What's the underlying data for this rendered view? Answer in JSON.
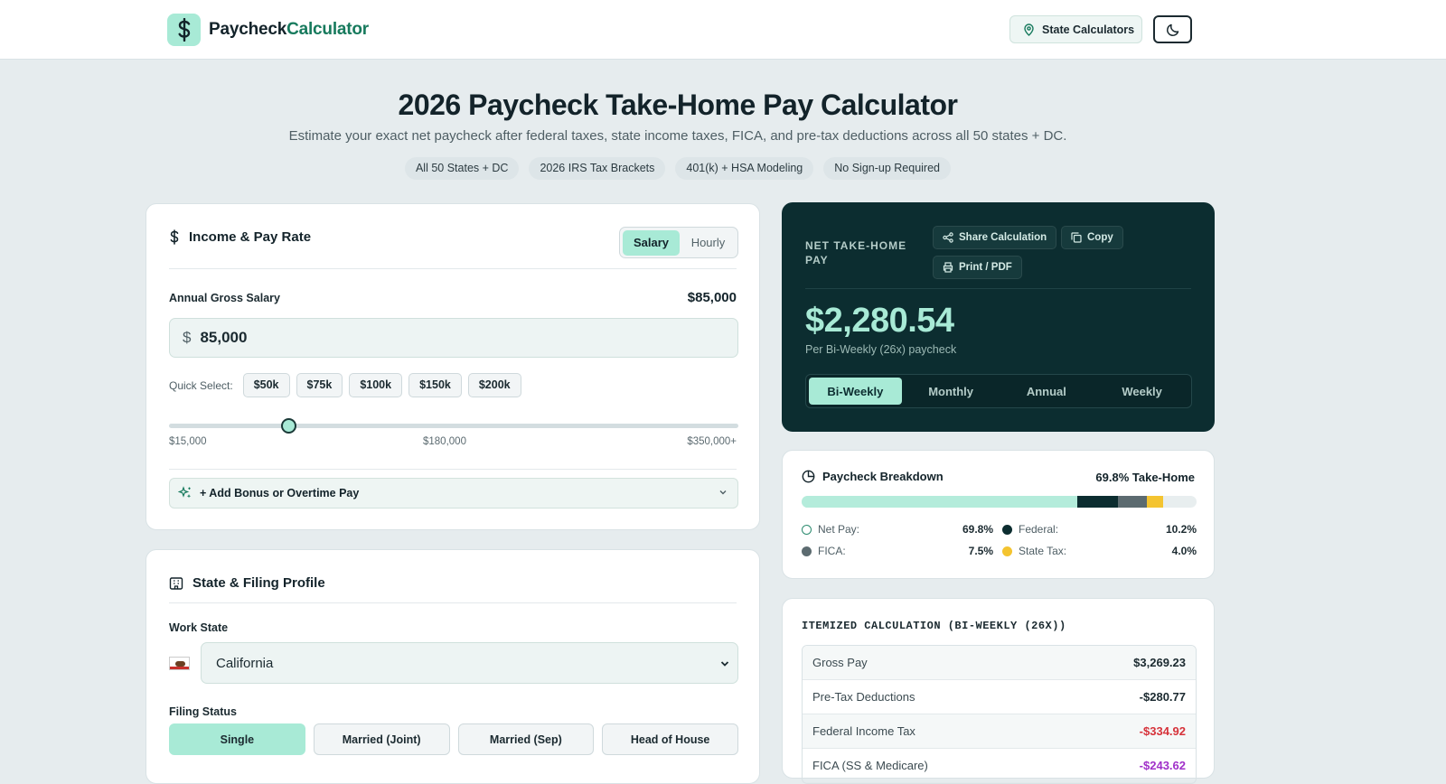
{
  "header": {
    "logo_text_a": "Paycheck",
    "logo_text_b": "Calculator",
    "state_calculators_label": "State Calculators"
  },
  "hero": {
    "title": "2026 Paycheck Take-Home Pay Calculator",
    "subtitle": "Estimate your exact net paycheck after federal taxes, state income taxes, FICA, and pre-tax deductions across all 50 states + DC.",
    "chips": [
      "All 50 States + DC",
      "2026 IRS Tax Brackets",
      "401(k) + HSA Modeling",
      "No Sign-up Required"
    ]
  },
  "income": {
    "title": "Income & Pay Rate",
    "mode_salary": "Salary",
    "mode_hourly": "Hourly",
    "salary_label": "Annual Gross Salary",
    "salary_display": "$85,000",
    "currency": "$",
    "salary_input_value": "85,000",
    "quick_label": "Quick Select:",
    "quick_options": [
      "$50k",
      "$75k",
      "$100k",
      "$150k",
      "$200k"
    ],
    "slider_min_label": "$15,000",
    "slider_mid_label": "$180,000",
    "slider_max_label": "$350,000+",
    "slider_value": 85000,
    "bonus_label": "+ Add Bonus or Overtime Pay"
  },
  "profile": {
    "title": "State & Filing Profile",
    "work_state_label": "Work State",
    "work_state_value": "California",
    "filing_label": "Filing Status",
    "filing_options": [
      "Single",
      "Married (Joint)",
      "Married (Sep)",
      "Head of House"
    ],
    "filing_selected": "Single"
  },
  "result": {
    "net_label": "NET TAKE-HOME PAY",
    "share_label": "Share Calculation",
    "copy_label": "Copy",
    "print_label": "Print / PDF",
    "amount": "$2,280.54",
    "per_text": "Per Bi-Weekly (26x) paycheck",
    "frequencies": [
      "Bi-Weekly",
      "Monthly",
      "Annual",
      "Weekly"
    ],
    "selected_frequency": "Bi-Weekly"
  },
  "breakdown": {
    "title": "Paycheck Breakdown",
    "take_home_text": "69.8% Take-Home",
    "segments": [
      {
        "name": "Net Pay:",
        "value": "69.8%",
        "percent": 69.8,
        "color": "#b4ecdb"
      },
      {
        "name": "Federal:",
        "value": "10.2%",
        "percent": 10.2,
        "color": "#0c2d30"
      },
      {
        "name": "FICA:",
        "value": "7.5%",
        "percent": 7.5,
        "color": "#5c6b70"
      },
      {
        "name": "State Tax:",
        "value": "4.0%",
        "percent": 4.0,
        "color": "#f4c430"
      }
    ]
  },
  "itemized": {
    "title": "ITEMIZED CALCULATION (BI-WEEKLY (26X))",
    "rows": [
      {
        "label": "Gross Pay",
        "value": "$3,269.23"
      },
      {
        "label": "Pre-Tax Deductions",
        "value": "-$280.77"
      },
      {
        "label": "Federal Income Tax",
        "value": "-$334.92"
      },
      {
        "label": "FICA (SS & Medicare)",
        "value": "-$243.62"
      }
    ]
  },
  "colors": {
    "accent": "#a8ead6",
    "dark": "#0c2d30",
    "negative": "#d6323a",
    "fica": "#a030c9"
  }
}
